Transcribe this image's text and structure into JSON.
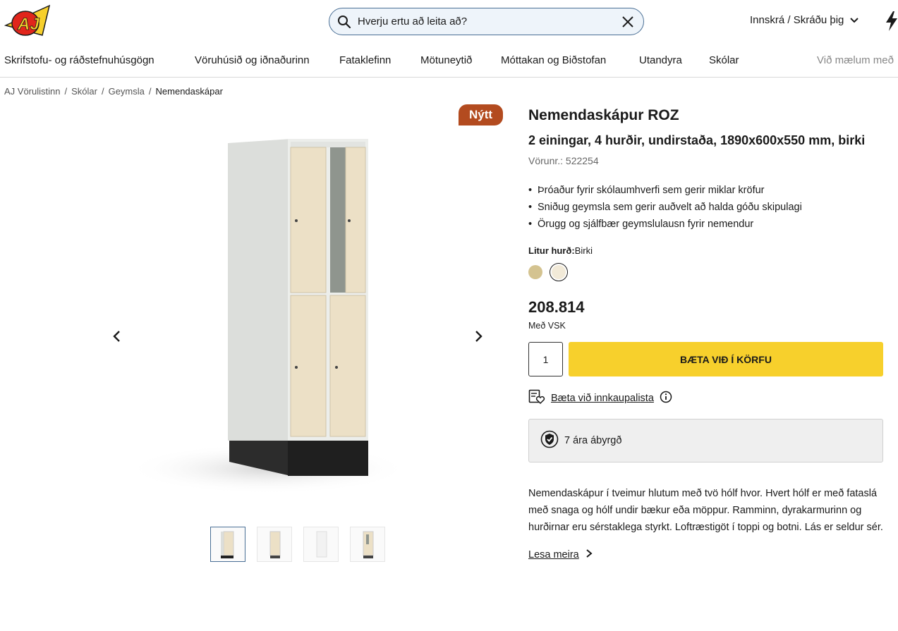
{
  "header": {
    "logo_text": "AJ",
    "search_placeholder": "Hverju ertu að leita að?",
    "login_label": "Innskrá / Skráðu þig"
  },
  "nav": {
    "items": [
      "Skrifstofu- og ráðstefnuhúsgögn",
      "Vöruhúsið og iðnaðurinn",
      "Fataklefinn",
      "Mötuneytið",
      "Móttakan og Biðstofan",
      "Utandyra",
      "Skólar",
      "Við mælum með"
    ]
  },
  "breadcrumb": {
    "items": [
      "AJ Vörulistinn",
      "Skólar",
      "Geymsla"
    ],
    "separator": "/",
    "current": "Nemendaskápar"
  },
  "product": {
    "badge": "Nýtt",
    "title": "Nemendaskápur ROZ",
    "subtitle": "2 einingar, 4 hurðir, undirstaða, 1890x600x550 mm, birki",
    "sku": "Vörunr.: 522254",
    "bullets": [
      "Þróaður fyrir skólaumhverfi sem gerir miklar kröfur",
      "Sniðug geymsla sem gerir auðvelt að halda góðu skipulagi",
      "Örugg og sjálfbær geymslulausn fyrir nemendur"
    ],
    "color_label": "Litur hurð:",
    "color_value": "Birki",
    "swatches": [
      "#d4c390",
      "#f2ead8"
    ],
    "price": "208.814",
    "vat": "Með VSK",
    "qty": "1",
    "add_to_cart": "BÆTA VIÐ Í KÖRFU",
    "wishlist": "Bæta við innkaupalista",
    "warranty": "7 ára ábyrgð",
    "description": "Nemendaskápur í tveimur hlutum með tvö hólf hvor. Hvert hólf er með fataslá með snaga og hólf undir bækur eða möppur. Ramminn, dyrakarmurinn og hurðirnar eru sérstaklega styrkt. Loftræstigöt í toppi og botni. Lás er seldur sér.",
    "read_more": "Lesa meira"
  },
  "colors": {
    "accent": "#f7d02c",
    "badge": "#b34b1f",
    "search_border": "#4a6f95",
    "logo_red": "#e1251b",
    "logo_yellow": "#f7d02c"
  }
}
